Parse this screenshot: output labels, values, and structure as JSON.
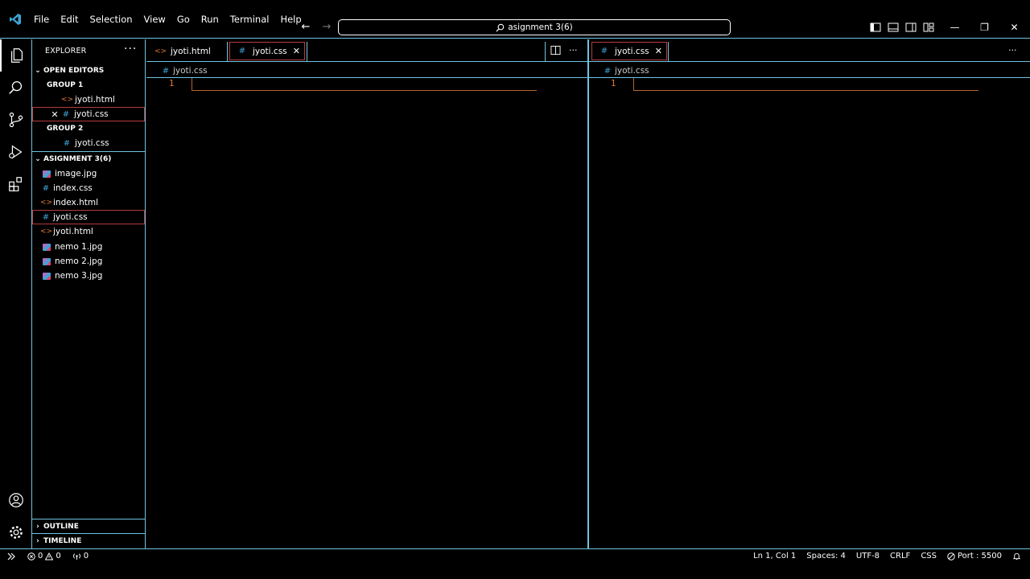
{
  "menu": [
    "File",
    "Edit",
    "Selection",
    "View",
    "Go",
    "Run",
    "Terminal",
    "Help"
  ],
  "command_center": {
    "text": "asignment 3(6)"
  },
  "window_controls": {
    "minimize": "—",
    "restore": "❐",
    "close": "✕"
  },
  "nav": {
    "back": "←",
    "forward": "→"
  },
  "explorer": {
    "title": "EXPLORER",
    "more": "···",
    "open_editors": {
      "label": "OPEN EDITORS",
      "group1": {
        "label": "GROUP 1",
        "files": [
          "jyoti.html",
          "jyoti.css"
        ]
      },
      "group2": {
        "label": "GROUP 2",
        "files": [
          "jyoti.css"
        ]
      }
    },
    "folder": {
      "label": "ASIGNMENT 3(6)",
      "files": [
        "image.jpg",
        "index.css",
        "index.html",
        "jyoti.css",
        "jyoti.html",
        "nemo 1.jpg",
        "nemo 2.jpg",
        "nemo 3.jpg"
      ]
    },
    "outline": "OUTLINE",
    "timeline": "TIMELINE"
  },
  "editor_left": {
    "tabs": [
      {
        "label": "jyoti.html",
        "type": "html"
      },
      {
        "label": "jyoti.css",
        "type": "css",
        "close": "✕"
      }
    ],
    "breadcrumb": "jyoti.css",
    "line": "1",
    "more": "···"
  },
  "editor_right": {
    "tabs": [
      {
        "label": "jyoti.css",
        "type": "css",
        "close": "✕"
      }
    ],
    "breadcrumb": "jyoti.css",
    "line": "1",
    "more": "···"
  },
  "status": {
    "errors": "0",
    "warnings": "0",
    "ports": "0",
    "position": "Ln 1, Col 1",
    "spaces": "Spaces: 4",
    "encoding": "UTF-8",
    "eol": "CRLF",
    "language": "CSS",
    "port": "Port : 5500"
  },
  "colors": {
    "accent": "#6fc3df",
    "active_border": "#b53b3b",
    "css_icon": "#3fa3d6",
    "html_icon": "#e37933"
  }
}
